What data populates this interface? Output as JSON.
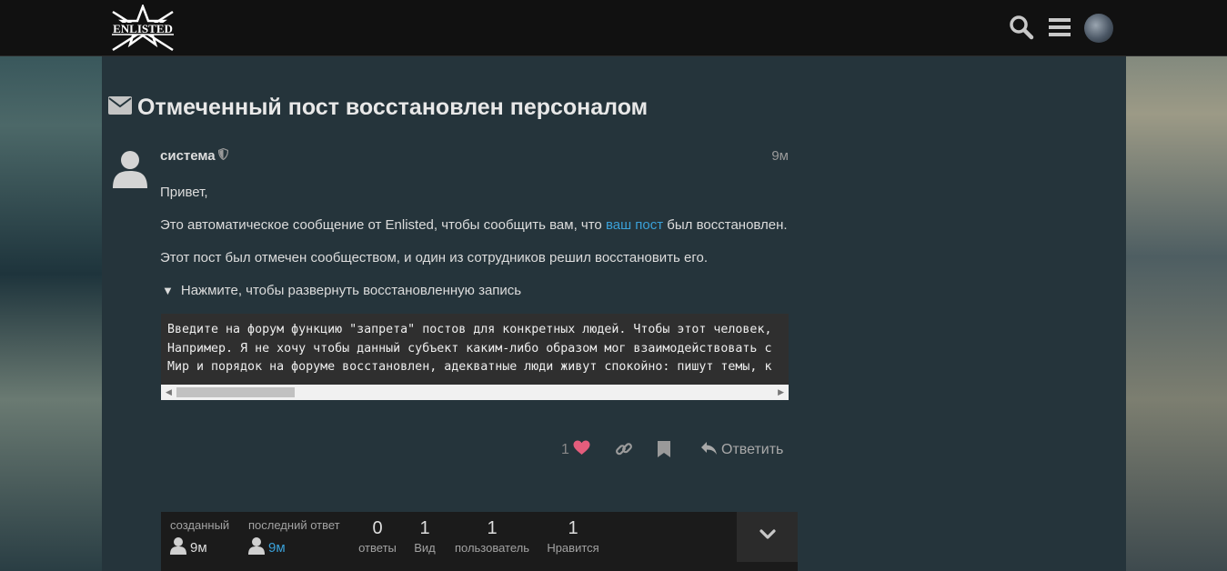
{
  "header": {
    "logo_text": "ENLISTED",
    "icons": [
      "search-icon",
      "hamburger-menu-icon",
      "user-avatar"
    ]
  },
  "topic": {
    "title": "Отмеченный пост восстановлен персоналом",
    "title_icon": "envelope-icon"
  },
  "post": {
    "username": "система",
    "badge_icon": "shield-icon",
    "time": "9м",
    "greeting": "Привет,",
    "line2_before": "Это автоматическое сообщение от Enlisted, чтобы сообщить вам, что ",
    "line2_link": "ваш пост",
    "line2_after": " был восстановлен.",
    "line3": "Этот пост был отмечен сообществом, и один из сотрудников решил восстановить его.",
    "summary_marker": "▼",
    "summary": "Нажмите, чтобы развернуть восстановленную запись",
    "code_lines": [
      "Введите на форум функцию \"запрета\" постов для конкретных людей. Чтобы этот человек,",
      "Например. Я не хочу чтобы данный субъект каким-либо образом мог взаимодействовать с",
      "Мир и порядок на форуме восстановлен, адекватные люди живут спокойно: пишут темы, к"
    ],
    "like_count": "1",
    "reply_label": "Ответить"
  },
  "topic_map": {
    "created_label": "созданный",
    "created_value": "9м",
    "last_reply_label": "последний ответ",
    "last_reply_value": "9м",
    "stats": [
      {
        "num": "0",
        "label": "ответы"
      },
      {
        "num": "1",
        "label": "Вид"
      },
      {
        "num": "1",
        "label": "пользователь"
      },
      {
        "num": "1",
        "label": "Нравится"
      }
    ]
  },
  "colors": {
    "header_bg": "#111111",
    "content_bg": "#25343b",
    "link": "#3aa0d8",
    "like_heart": "#e45d7c"
  }
}
